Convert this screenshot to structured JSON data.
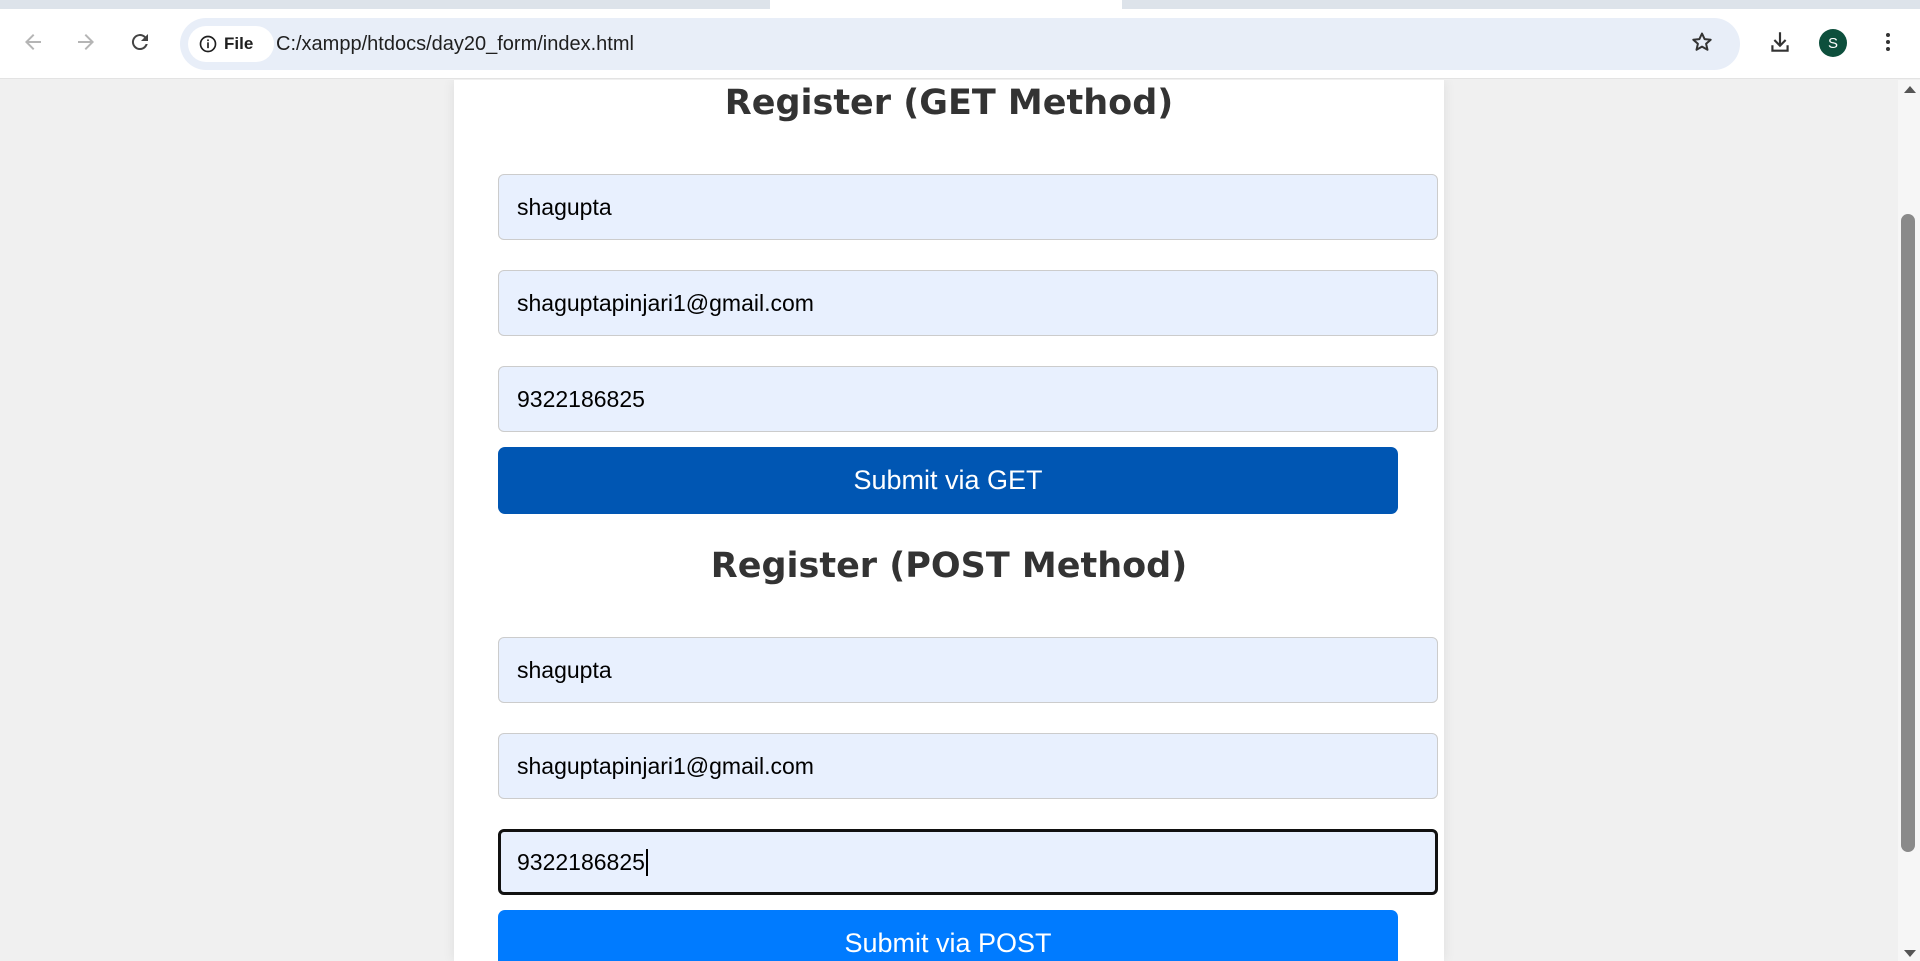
{
  "browser": {
    "site_chip_label": "File",
    "url": "C:/xampp/htdocs/day20_form/index.html",
    "avatar_letter": "S",
    "avatar_color": "#0d4f3c"
  },
  "get_form": {
    "title": "Register (GET Method)",
    "name_value": "shagupta",
    "email_value": "shaguptapinjari1@gmail.com",
    "phone_value": "9322186825",
    "submit_label": "Submit via GET",
    "submit_color": "#0056b3"
  },
  "post_form": {
    "title": "Register (POST Method)",
    "name_value": "shagupta",
    "email_value": "shaguptapinjari1@gmail.com",
    "phone_value": "9322186825",
    "submit_label": "Submit via POST",
    "submit_color": "#007bff"
  },
  "icons": {
    "back": "arrow-left-icon",
    "forward": "arrow-right-icon",
    "reload": "reload-icon",
    "site_info": "info-icon",
    "bookmark": "star-icon",
    "downloads": "download-icon",
    "menu": "more-vert-icon"
  }
}
